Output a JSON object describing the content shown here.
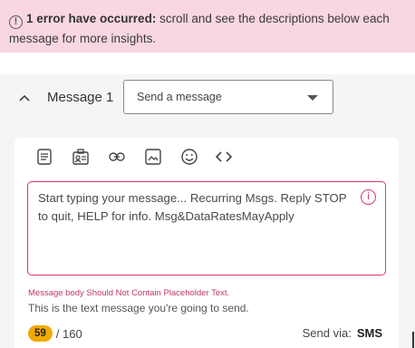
{
  "error_banner": {
    "bold_text": "1 error have occurred:",
    "text": " scroll and see the descriptions below each message for more insights.",
    "icon": "alert-circle-icon"
  },
  "message": {
    "title": "Message 1",
    "type_select": {
      "value": "Send a message"
    },
    "toolbar": [
      "text-icon",
      "contact-card-icon",
      "link-icon",
      "image-icon",
      "emoji-icon",
      "code-icon"
    ],
    "body": "Start typing your message... Recurring Msgs. Reply STOP to quit, HELP for info. Msg&DataRatesMayApply",
    "error": "Message body Should Not Contain Placeholder Text.",
    "hint": "This is the text message you're going to send.",
    "char_count": "59",
    "char_limit": "/ 160",
    "send_via_label": "Send via:",
    "send_via_value": "SMS"
  },
  "colors": {
    "error_banner_bg": "#f8d7e2",
    "error_accent": "#d63a6c",
    "count_badge": "#f2a900",
    "panel_bg": "#f6f5f3"
  }
}
